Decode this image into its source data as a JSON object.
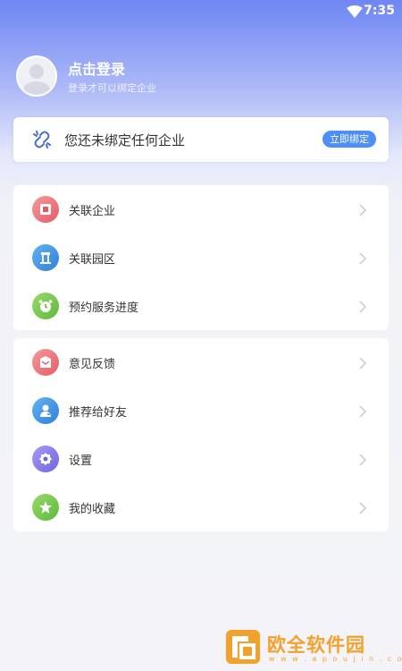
{
  "status_bar": {
    "time": "7:35",
    "wifi_icon": "wifi-icon"
  },
  "profile": {
    "avatar_icon": "avatar-placeholder-icon",
    "title": "点击登录",
    "subtitle": "登录才可以绑定企业"
  },
  "bind_card": {
    "icon": "link-icon",
    "text": "您还未绑定任何企业",
    "button_label": "立即绑定",
    "accent": "#4d8ef7"
  },
  "menu_group_1": [
    {
      "label": "关联企业",
      "icon": "building-icon",
      "color": "#e75a63"
    },
    {
      "label": "关联园区",
      "icon": "park-icon",
      "color": "#2f7fd8"
    },
    {
      "label": "预约服务进度",
      "icon": "alarm-clock-icon",
      "color": "#5cba3a"
    }
  ],
  "menu_group_2": [
    {
      "label": "意见反馈",
      "icon": "feedback-icon",
      "color": "#e75a63"
    },
    {
      "label": "推荐给好友",
      "icon": "share-user-icon",
      "color": "#2f7fd8"
    },
    {
      "label": "设置",
      "icon": "gear-icon",
      "color": "#6f63e0"
    },
    {
      "label": "我的收藏",
      "icon": "star-icon",
      "color": "#5cba3a"
    }
  ],
  "watermark": {
    "text": "欧全软件园",
    "url": "w w w . a p o u j i n . c o m",
    "color": "#f2a22c"
  }
}
